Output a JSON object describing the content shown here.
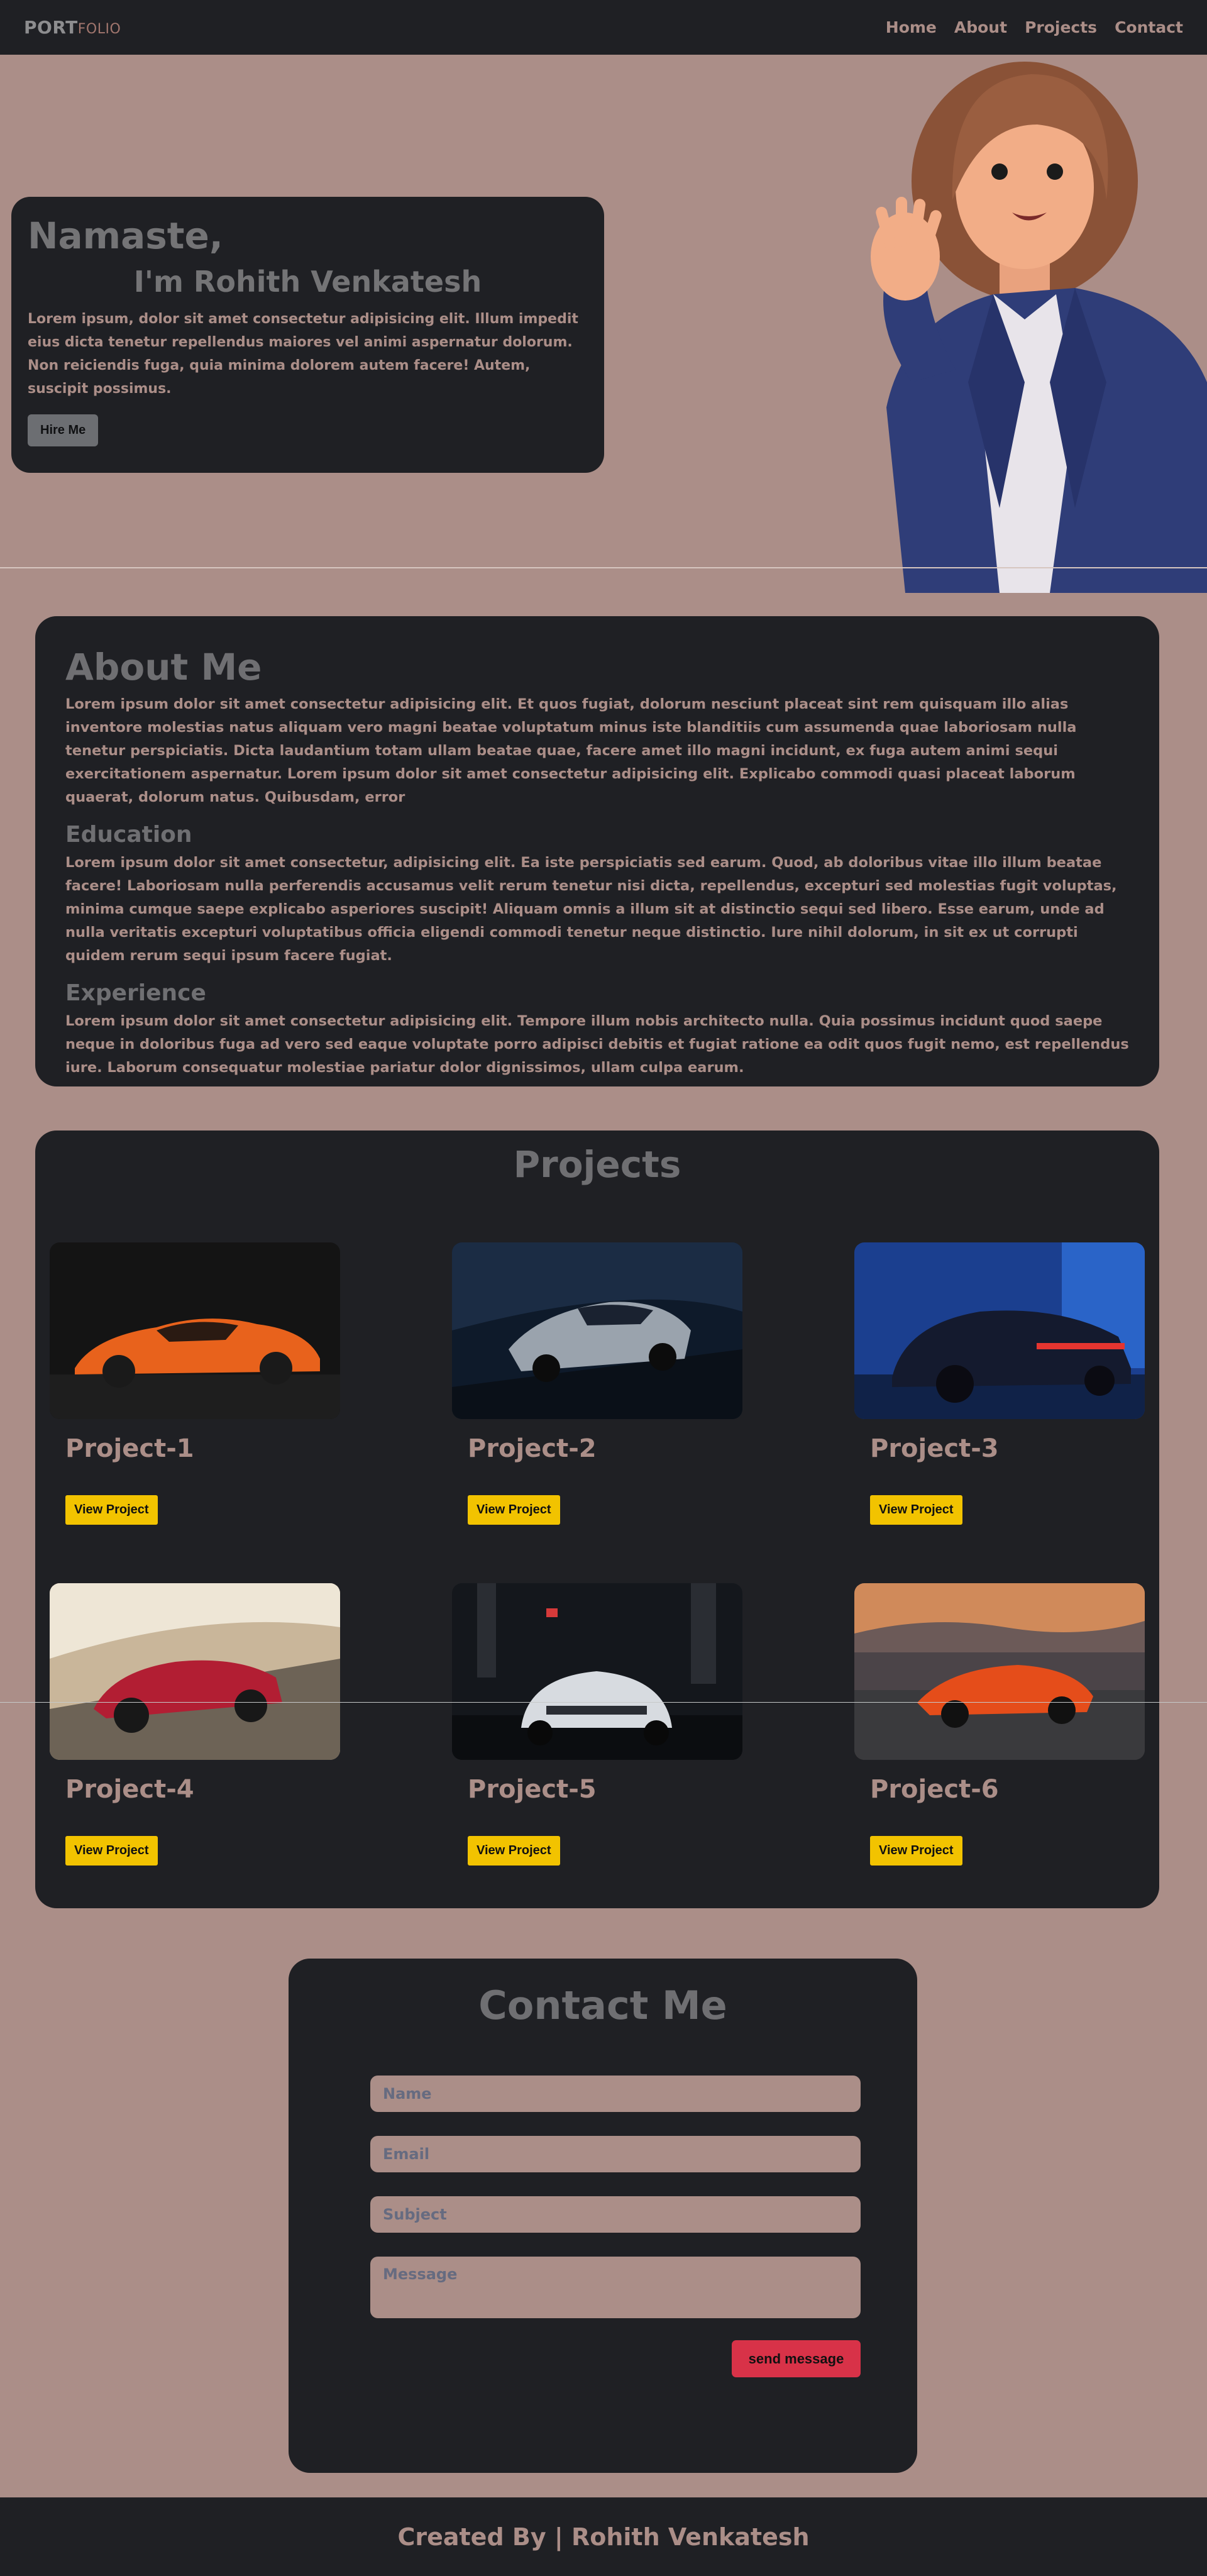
{
  "nav": {
    "logo_main": "PORT",
    "logo_sub": "FOLIO",
    "links": [
      "Home",
      "About",
      "Projects",
      "Contact"
    ]
  },
  "hero": {
    "greeting": "Namaste,",
    "name": "I'm Rohith Venkatesh",
    "text": "Lorem ipsum, dolor sit amet consectetur adipisicing elit. Illum impedit eius dicta tenetur repellendus maiores vel animi aspernatur dolorum. Non reiciendis fuga, quia minima dolorem autem facere! Autem, suscipit possimus.",
    "button": "Hire Me",
    "image_icon": "avatar-woman-waving"
  },
  "about": {
    "title": "About Me",
    "intro": "Lorem ipsum dolor sit amet consectetur adipisicing elit. Et quos fugiat, dolorum nesciunt placeat sint rem quisquam illo alias inventore molestias natus aliquam vero magni beatae voluptatum minus iste blanditiis cum assumenda quae laboriosam nulla tenetur perspiciatis. Dicta laudantium totam ullam beatae quae, facere amet illo magni incidunt, ex fuga autem animi sequi exercitationem aspernatur. Lorem ipsum dolor sit amet consectetur adipisicing elit. Explicabo commodi quasi placeat laborum quaerat, dolorum natus. Quibusdam, error",
    "education_title": "Education",
    "education_text": "Lorem ipsum dolor sit amet consectetur, adipisicing elit. Ea iste perspiciatis sed earum. Quod, ab doloribus vitae illo illum beatae facere! Laboriosam nulla perferendis accusamus velit rerum tenetur nisi dicta, repellendus, excepturi sed molestias fugit voluptas, minima cumque saepe explicabo asperiores suscipit! Aliquam omnis a illum sit at distinctio sequi sed libero. Esse earum, unde ad nulla veritatis excepturi voluptatibus officia eligendi commodi tenetur neque distinctio. Iure nihil dolorum, in sit ex ut corrupti quidem rerum sequi ipsum facere fugiat.",
    "experience_title": "Experience",
    "experience_text": "Lorem ipsum dolor sit amet consectetur adipisicing elit. Tempore illum nobis architecto nulla. Quia possimus incidunt quod saepe neque in doloribus fuga ad vero sed eaque voluptate porro adipisci debitis et fugiat ratione ea odit quos fugit nemo, est repellendus iure. Laborum consequatur molestiae pariatur dolor dignissimos, ullam culpa earum."
  },
  "projects": {
    "title": "Projects",
    "button_label": "View Project",
    "items": [
      {
        "title": "Project-1",
        "image": "orange-sports-car"
      },
      {
        "title": "Project-2",
        "image": "silver-supercar"
      },
      {
        "title": "Project-3",
        "image": "dark-blue-porsche"
      },
      {
        "title": "Project-4",
        "image": "red-roadster"
      },
      {
        "title": "Project-5",
        "image": "white-muscle-car"
      },
      {
        "title": "Project-6",
        "image": "orange-mclaren"
      }
    ]
  },
  "contact": {
    "title": "Contact Me",
    "name_placeholder": "Name",
    "email_placeholder": "Email",
    "subject_placeholder": "Subject",
    "message_placeholder": "Message",
    "send_label": "send message"
  },
  "footer": {
    "text": "Created By | Rohith Venkatesh"
  },
  "colors": {
    "background": "#ab8e88",
    "card": "#1f2024",
    "accent_yellow": "#f2c300",
    "accent_red": "#d83248"
  }
}
